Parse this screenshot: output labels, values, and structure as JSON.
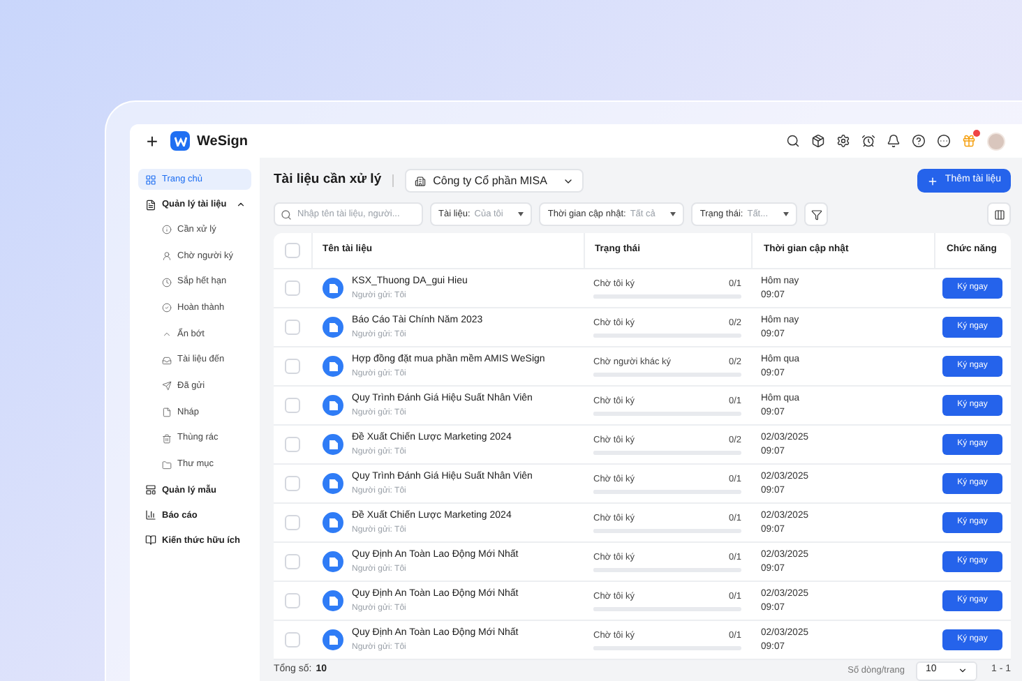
{
  "app": {
    "brand": "WeSign",
    "new_button": "+"
  },
  "sidebar": {
    "items": [
      {
        "label": "Trang chủ",
        "selected": true
      },
      {
        "label": "Quản lý tài liệu",
        "selected": false,
        "expanded": true,
        "children": [
          {
            "label": "Cần xử lý",
            "selected": false
          },
          {
            "label": "Chờ người ký",
            "selected": false
          },
          {
            "label": "Sắp hết hạn",
            "selected": false
          },
          {
            "label": "Hoàn thành",
            "selected": false
          },
          {
            "label": "Ẩn bớt",
            "selected": false
          },
          {
            "label": "Tài liệu đến",
            "selected": false
          },
          {
            "label": "Đã gửi",
            "selected": false
          },
          {
            "label": "Nháp",
            "selected": false
          },
          {
            "label": "Thùng rác",
            "selected": false
          },
          {
            "label": "Thư mục",
            "selected": false
          }
        ]
      },
      {
        "label": "Quản lý mẫu",
        "selected": false
      },
      {
        "label": "Báo cáo",
        "selected": false
      },
      {
        "label": "Kiến thức hữu ích",
        "selected": false
      }
    ]
  },
  "header": {
    "title": "Tài liệu cần xử lý",
    "company": "Công ty Cổ phần MISA",
    "add_button": "Thêm tài liệu"
  },
  "filters": {
    "search_placeholder": "Nhập tên tài liệu, người...",
    "dropdowns": [
      {
        "label": "Tài liệu:",
        "value": "Của tôi"
      },
      {
        "label": "Thời gian cập nhật:",
        "value": "Tất cả"
      },
      {
        "label": "Trạng thái:",
        "value": "Tất..."
      }
    ]
  },
  "table": {
    "select_all_checked": false,
    "columns": [
      "Tên tài liệu",
      "Trạng thái",
      "Thời gian cập nhật",
      "Chức năng"
    ],
    "rows": [
      {
        "name": "KSX_Thuong DA_gui Hieu",
        "sender": "Người gửi: Tôi",
        "status": "Chờ tôi ký",
        "count": "0/1",
        "level": 0,
        "date": "Hôm nay",
        "time": "09:07",
        "action": "Ký ngay",
        "checked": false
      },
      {
        "name": "Báo Cáo Tài Chính Năm 2023",
        "sender": "Người gửi: Tôi",
        "status": "Chờ tôi ký",
        "count": "0/2",
        "level": 0,
        "date": "Hôm nay",
        "time": "09:07",
        "action": "Ký ngay",
        "checked": false
      },
      {
        "name": "Hợp đồng đặt mua phần mềm AMIS WeSign",
        "sender": "Người gửi: Tôi",
        "status": "Chờ người khác ký",
        "count": "0/2",
        "level": 0,
        "date": "Hôm qua",
        "time": "09:07",
        "action": "Ký ngay",
        "checked": false
      },
      {
        "name": "Quy Trình Đánh Giá Hiệu Suất Nhân Viên",
        "sender": "Người gửi: Tôi",
        "status": "Chờ tôi ký",
        "count": "0/1",
        "level": 0,
        "date": "Hôm qua",
        "time": "09:07",
        "action": "Ký ngay",
        "checked": false
      },
      {
        "name": "Đề Xuất Chiến Lược Marketing 2024",
        "sender": "Người gửi: Tôi",
        "status": "Chờ tôi ký",
        "count": "0/2",
        "level": 0,
        "date": "02/03/2025",
        "time": "09:07",
        "action": "Ký ngay",
        "checked": false
      },
      {
        "name": "Quy Trình Đánh Giá Hiệu Suất Nhân Viên",
        "sender": "Người gửi: Tôi",
        "status": "Chờ tôi ký",
        "count": "0/1",
        "level": 0,
        "date": "02/03/2025",
        "time": "09:07",
        "action": "Ký ngay",
        "checked": false
      },
      {
        "name": "Đề Xuất Chiến Lược Marketing 2024",
        "sender": "Người gửi: Tôi",
        "status": "Chờ tôi ký",
        "count": "0/1",
        "level": 0,
        "date": "02/03/2025",
        "time": "09:07",
        "action": "Ký ngay",
        "checked": false
      },
      {
        "name": "Quy Định An Toàn Lao Động Mới Nhất",
        "sender": "Người gửi: Tôi",
        "status": "Chờ tôi ký",
        "count": "0/1",
        "level": 0,
        "date": "02/03/2025",
        "time": "09:07",
        "action": "Ký ngay",
        "checked": false
      },
      {
        "name": "Quy Định An Toàn Lao Động Mới Nhất",
        "sender": "Người gửi: Tôi",
        "status": "Chờ tôi ký",
        "count": "0/1",
        "level": 0,
        "date": "02/03/2025",
        "time": "09:07",
        "action": "Ký ngay",
        "checked": false
      },
      {
        "name": "Quy Định An Toàn Lao Động Mới Nhất",
        "sender": "Người gửi: Tôi",
        "status": "Chờ tôi ký",
        "count": "0/1",
        "level": 0,
        "date": "02/03/2025",
        "time": "09:07",
        "action": "Ký ngay",
        "checked": false
      }
    ]
  },
  "footer": {
    "total_label": "Tổng số:",
    "total": "10",
    "rows_per_page_label": "Số dòng/trang",
    "rows_per_page": "10",
    "range": "1 - 1"
  }
}
